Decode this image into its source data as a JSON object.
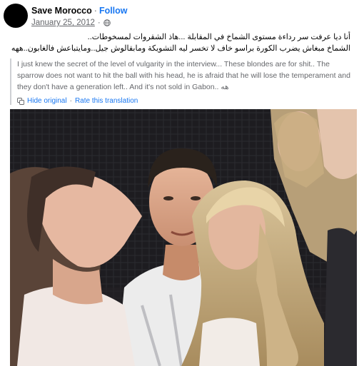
{
  "post": {
    "author": "Save Morocco",
    "separator": "·",
    "follow_label": "Follow",
    "date": "January 25, 2012",
    "date_separator": "·",
    "privacy_icon": "globe-icon",
    "original_text_line1": "أنا ديا عرفت سر رداءة مستوى الشماخ في المقابلة ...هاذ الشقروات لمسخوطات..",
    "original_text_line2": "الشماخ مبغاش يضرب الكورة براسو خاف لا تخسر ليه التشويكة ومابقالوش جيل..ومايتباعش فالغابون..ههه",
    "translation_text": "I just knew the secret of the level of vulgarity in the interview... These blondes are for shit.. The sparrow does not want to hit the ball with his head, he is afraid that he will lose the temperament and they don't have a generation left.. And it's not sold in Gabon.. هه",
    "translate_icon": "translate-icon",
    "hide_original_label": "Hide original",
    "actions_separator": "·",
    "rate_translation_label": "Rate this translation"
  },
  "colors": {
    "link_blue": "#1877f2",
    "secondary_text": "#65676b",
    "primary_text": "#050505"
  }
}
